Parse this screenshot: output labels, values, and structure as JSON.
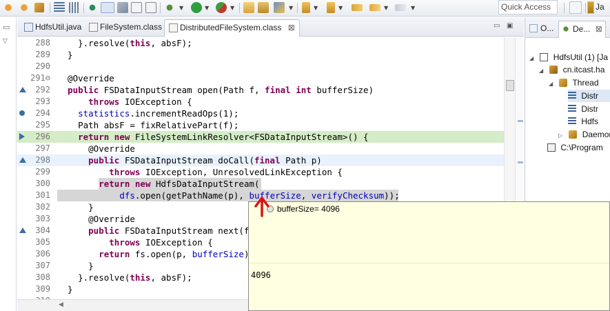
{
  "toolbar": {
    "quick_access_placeholder": "Quick Access",
    "perspective_label": "Ja"
  },
  "editor_tabs": [
    {
      "label": "HdfsUtil.java",
      "active": false
    },
    {
      "label": "FileSystem.class",
      "active": false
    },
    {
      "label": "DistributedFileSystem.class",
      "active": true,
      "close": "⊠"
    }
  ],
  "code_lines": [
    {
      "num": "288",
      "code": "    }.resolve(this, absF);"
    },
    {
      "num": "289",
      "code": "  }"
    },
    {
      "num": "290",
      "code": ""
    },
    {
      "num": "291⊖",
      "code": "  @Override"
    },
    {
      "num": "292",
      "code": "  public FSDataInputStream open(Path f, final int bufferSize)"
    },
    {
      "num": "293",
      "code": "      throws IOException {"
    },
    {
      "num": "294",
      "code": "    statistics.incrementReadOps(1);"
    },
    {
      "num": "295",
      "code": "    Path absF = fixRelativePart(f);"
    },
    {
      "num": "296",
      "code": "    return new FileSystemLinkResolver<FSDataInputStream>() {"
    },
    {
      "num": "297",
      "code": "      @Override"
    },
    {
      "num": "298",
      "code": "      public FSDataInputStream doCall(final Path p)"
    },
    {
      "num": "299",
      "code": "          throws IOException, UnresolvedLinkException {"
    },
    {
      "num": "300",
      "code": "        return new HdfsDataInputStream("
    },
    {
      "num": "301",
      "code": "            dfs.open(getPathName(p), bufferSize, verifyChecksum));"
    },
    {
      "num": "302",
      "code": "      }"
    },
    {
      "num": "303",
      "code": "      @Override"
    },
    {
      "num": "304",
      "code": "      public FSDataInputStream next(f"
    },
    {
      "num": "305",
      "code": "          throws IOException {"
    },
    {
      "num": "306",
      "code": "        return fs.open(p, bufferSize)"
    },
    {
      "num": "307",
      "code": "      }"
    },
    {
      "num": "308",
      "code": "    }.resolve(this, absF);"
    },
    {
      "num": "309",
      "code": "  }"
    },
    {
      "num": "310",
      "code": ""
    }
  ],
  "right_view": {
    "tabs": [
      {
        "label": "O...",
        "active": false
      },
      {
        "label": "De...",
        "active": true,
        "close": "⊠"
      }
    ],
    "tree": [
      {
        "label": "HdfsUtil (1) [Ja",
        "indent": 0
      },
      {
        "label": "cn.itcast.ha",
        "indent": 1
      },
      {
        "label": "Thread",
        "indent": 2
      },
      {
        "label": "Distr",
        "indent": 3
      },
      {
        "label": "Distr",
        "indent": 3
      },
      {
        "label": "Hdfs",
        "indent": 3
      },
      {
        "label": "Daemon",
        "indent": 2
      },
      {
        "label": "C:\\Program",
        "indent": 1
      }
    ]
  },
  "hover_popup": {
    "header": "bufferSize= 4096",
    "detail": "4096"
  },
  "colors": {
    "keyword": "#7f0055",
    "annotation": "#646464",
    "field": "#0000c0",
    "line_highlight_green": "#d4ecc7",
    "popup_bg": "#ffffe1"
  }
}
